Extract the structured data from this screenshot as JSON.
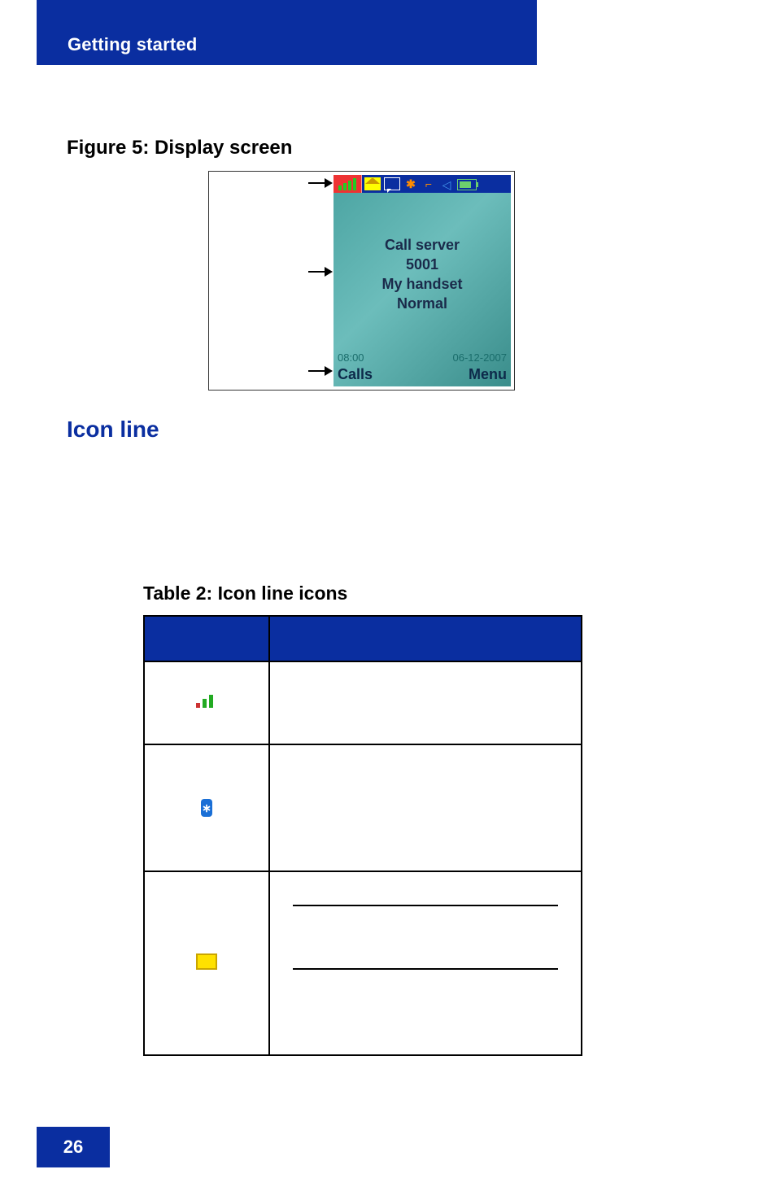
{
  "header": {
    "section": "Getting started"
  },
  "figure": {
    "caption": "Figure 5: Display screen",
    "screen": {
      "line1": "Call server",
      "line2": "5001",
      "line3": "My handset",
      "line4": "Normal",
      "time": "08:00",
      "date": "06-12-2007",
      "softkey_left": "Calls",
      "softkey_right": "Menu"
    }
  },
  "section": {
    "title": "Icon line"
  },
  "table": {
    "caption": "Table 2: Icon line icons",
    "headers": {
      "icon": "",
      "description": ""
    },
    "rows": [
      {
        "icon": "signal-strength-icon",
        "description": ""
      },
      {
        "icon": "bluetooth-icon",
        "description": ""
      },
      {
        "icon": "message-icon",
        "description": ""
      }
    ]
  },
  "page_number": "26"
}
